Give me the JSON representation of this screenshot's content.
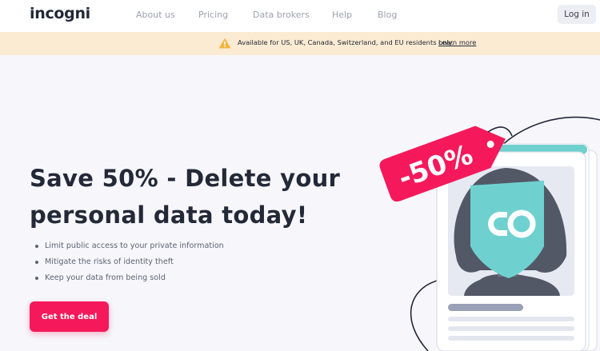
{
  "header": {
    "logo": "incogni",
    "nav": [
      "About us",
      "Pricing",
      "Data brokers",
      "Help",
      "Blog"
    ],
    "login_label": "Log in"
  },
  "notice": {
    "text": "Available for US, UK, Canada, Switzerland, and EU residents only.",
    "link": "Learn more",
    "icon": "warning-icon"
  },
  "hero": {
    "title_line1": "Save 50% - Delete your",
    "title_line2": "personal data today!",
    "bullets": [
      "Limit public access to your private information",
      "Mitigate the risks of identity theft",
      "Keep your data from being sold"
    ],
    "cta_label": "Get the deal"
  },
  "illustration": {
    "tag_text": "-50%"
  },
  "colors": {
    "accent": "#f5195b",
    "banner_bg": "#fbebd2",
    "page_bg": "#f7f7fb",
    "teal": "#6fd1cf",
    "dark": "#232838"
  }
}
